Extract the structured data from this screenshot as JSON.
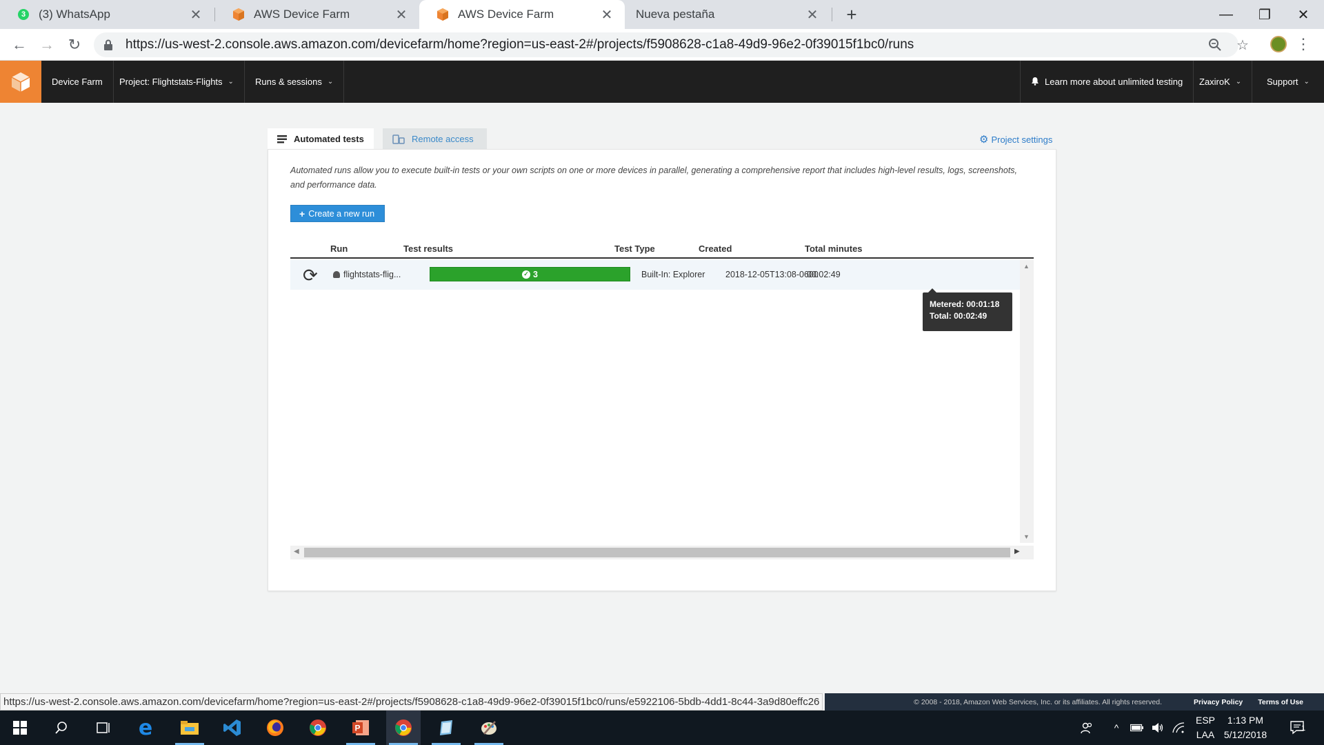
{
  "browser": {
    "tabs": [
      {
        "title": "(3) WhatsApp",
        "badge": "3"
      },
      {
        "title": "AWS Device Farm"
      },
      {
        "title": "AWS Device Farm"
      },
      {
        "title": "Nueva pestaña"
      }
    ],
    "url": "https://us-west-2.console.aws.amazon.com/devicefarm/home?region=us-east-2#/projects/f5908628-c1a8-49d9-96e2-0f39015f1bc0/runs"
  },
  "awsnav": {
    "service": "Device Farm",
    "project": "Project: Flightstats-Flights",
    "runs": "Runs & sessions",
    "learn_more": "Learn more about unlimited testing",
    "user": "ZaxiroK",
    "support": "Support"
  },
  "tabs": {
    "automated": "Automated tests",
    "remote": "Remote access",
    "project_settings": "Project settings"
  },
  "main": {
    "description": "Automated runs allow you to execute built-in tests or your own scripts on one or more devices in parallel, generating a comprehensive report that includes high-level results, logs, screenshots, and performance data.",
    "create_button": "Create a new run"
  },
  "runs_table": {
    "headers": {
      "run": "Run",
      "results": "Test results",
      "type": "Test Type",
      "created": "Created",
      "minutes": "Total minutes"
    },
    "rows": [
      {
        "run": "flightstats-flig...",
        "passed": "3",
        "type": "Built-In: Explorer",
        "created": "2018-12-05T13:08-0600",
        "minutes": "00:02:49"
      }
    ]
  },
  "tooltip": {
    "metered": "Metered: 00:01:18",
    "total": "Total: 00:02:49"
  },
  "status_url": "https://us-west-2.console.aws.amazon.com/devicefarm/home?region=us-east-2#/projects/f5908628-c1a8-49d9-96e2-0f39015f1bc0/runs/e5922106-5bdb-4dd1-8c44-3a9d80effc26",
  "footer": {
    "copyright": "© 2008 - 2018, Amazon Web Services, Inc. or its affiliates. All rights reserved.",
    "privacy": "Privacy Policy",
    "terms": "Terms of Use"
  },
  "taskbar": {
    "lang1": "ESP",
    "lang2": "LAA",
    "time": "1:13 PM",
    "date": "5/12/2018",
    "notifications": "1"
  },
  "colors": {
    "aws_orange": "#ee8433",
    "aws_nav": "#1f1f1f",
    "primary_button": "#2d8ed9",
    "success": "#2ba22b"
  },
  "icons": [
    "whatsapp-icon",
    "aws-icon",
    "lock-icon",
    "zoom-icon",
    "star-icon",
    "refresh-icon",
    "android-icon",
    "check-icon",
    "gear-icon",
    "bell-icon",
    "windows-start-icon"
  ]
}
